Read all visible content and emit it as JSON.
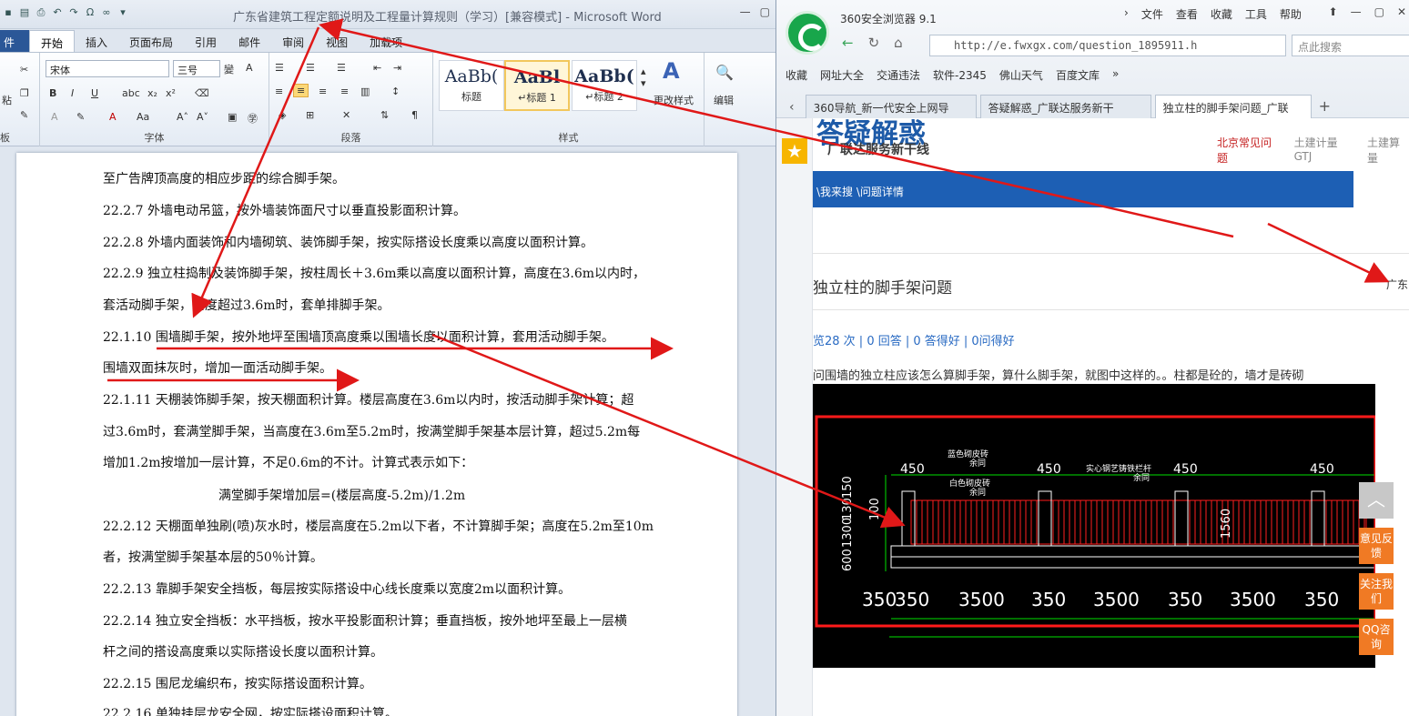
{
  "word": {
    "title": "广东省建筑工程定额说明及工程量计算规则（学习）[兼容模式] - Microsoft Word",
    "tabs": [
      "件",
      "开始",
      "插入",
      "页面布局",
      "引用",
      "邮件",
      "审阅",
      "视图",
      "加载项"
    ],
    "font_name": "宋体",
    "font_size": "三号",
    "group_labels": {
      "clipboard": "板",
      "font": "字体",
      "paragraph": "段落",
      "styles": "样式"
    },
    "clip_labels": [
      "粘"
    ],
    "styles": [
      {
        "preview": "AaBb(",
        "name": "标题"
      },
      {
        "preview": "AaBl",
        "name": "↵标题 1"
      },
      {
        "preview": "AaBb(",
        "name": "↵标题 2"
      }
    ],
    "change_styles": "更改样式",
    "edit": "编辑",
    "lines": [
      "至广告牌顶高度的相应步距的综合脚手架。",
      "22.2.7  外墙电动吊篮，按外墙装饰面尺寸以垂直投影面积计算。",
      "22.2.8  外墙内面装饰和内墙砌筑、装饰脚手架，按实际搭设长度乘以高度以面积计算。",
      "22.2.9  独立柱捣制及装饰脚手架，按柱周长＋3.6m乘以高度以面积计算，高度在3.6m以内时，",
      "套活动脚手架，高度超过3.6m时，套单排脚手架。",
      "22.1.10    围墙脚手架，按外地坪至围墙顶高度乘以围墙长度以面积计算，套用活动脚手架。",
      "围墙双面抹灰时，增加一面活动脚手架。",
      "22.1.11  天棚装饰脚手架，按天棚面积计算。楼层高度在3.6m以内时，按活动脚手架计算；超",
      "过3.6m时，套满堂脚手架，当高度在3.6m至5.2m时，按满堂脚手架基本层计算，超过5.2m每",
      "增加1.2m按增加一层计算，不足0.6m的不计。计算式表示如下：",
      "满堂脚手架增加层=(楼层高度-5.2m)/1.2m",
      "22.2.12  天棚面单独刷(喷)灰水时，楼层高度在5.2m以下者，不计算脚手架；高度在5.2m至10m",
      "者，按满堂脚手架基本层的50％计算。",
      "22.2.13  靠脚手架安全挡板，每层按实际搭设中心线长度乘以宽度2m以面积计算。",
      "22.2.14  独立安全挡板：水平挡板，按水平投影面积计算；垂直挡板，按外地坪至最上一层横",
      "杆之间的搭设高度乘以实际搭设长度以面积计算。",
      "22.2.15  围尼龙编织布，按实际搭设面积计算。",
      "22.2.16  单独挂层龙安全网，按实际搭设面积计算。"
    ]
  },
  "browser": {
    "name": "360安全浏览器 9.1",
    "menu": [
      "文件",
      "查看",
      "收藏",
      "工具",
      "帮助"
    ],
    "url": "http://e.fwxgx.com/question_1895911.h",
    "search_placeholder": "点此搜索",
    "bookmarks": [
      "收藏",
      "网址大全",
      "交通违法",
      "软件-2345",
      "佛山天气",
      "百度文库"
    ],
    "tabs": [
      "360导航_新一代安全上网导",
      "答疑解惑_广联达服务新干",
      "独立柱的脚手架问题_广联"
    ],
    "site_logo": "答疑解惑",
    "slogan": "广联达服务新干线",
    "top_links": [
      "北京常见问题",
      "土建计量GTJ",
      "土建算量"
    ],
    "breadcrumb": "\\我来搜 \\问题详情",
    "question_title": "独立柱的脚手架问题",
    "right_link": "广东",
    "stats": "览28 次 | 0 回答 | 0 答得好 | 0问得好",
    "question_text": "问围墙的独立柱应该怎么算脚手架，算什么脚手架，就图中这样的。。柱都是砼的，墙才是砖砌",
    "cad": {
      "dims_top": [
        "450",
        "450",
        "450",
        "450"
      ],
      "dims_bottom": [
        "350",
        "350",
        "3500",
        "350",
        "3500",
        "350",
        "3500",
        "350"
      ],
      "left_dims": [
        "150",
        "130",
        "100",
        "1300",
        "600"
      ],
      "mid_dim": "1560",
      "notes": [
        "蓝色砌皮砖",
        "余同",
        "白色砌皮砖",
        "余同",
        "实心钢艺铸铁栏杆",
        "余同"
      ]
    },
    "side_buttons": [
      "意见反馈",
      "关注我们",
      "QQ咨询"
    ]
  }
}
